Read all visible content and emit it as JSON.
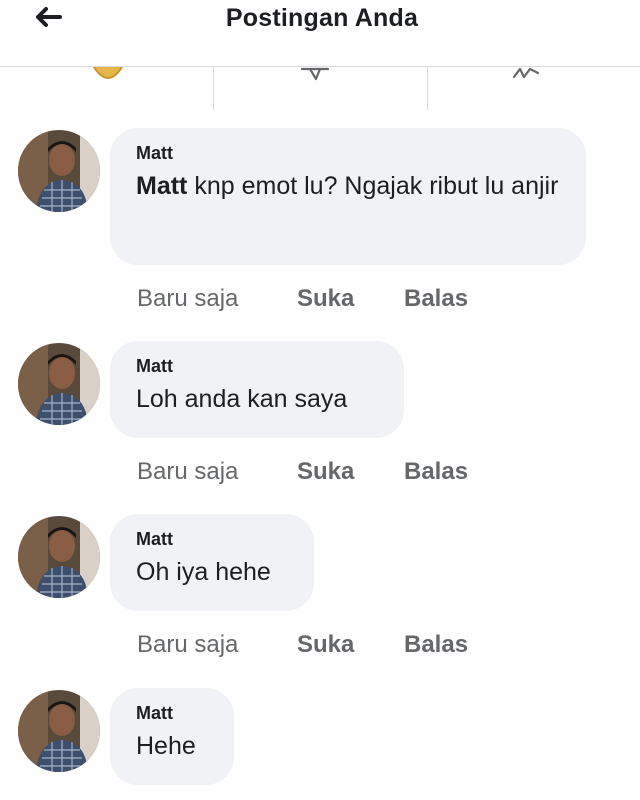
{
  "header": {
    "title": "Postingan Anda"
  },
  "comments": [
    {
      "author": "Matt",
      "mention": "Matt",
      "text": " knp emot lu? Ngajak ribut lu anjir",
      "time": "Baru saja",
      "like": "Suka",
      "reply": "Balas"
    },
    {
      "author": "Matt",
      "text": "Loh anda kan saya",
      "time": "Baru saja",
      "like": "Suka",
      "reply": "Balas"
    },
    {
      "author": "Matt",
      "text": "Oh iya hehe",
      "time": "Baru saja",
      "like": "Suka",
      "reply": "Balas"
    },
    {
      "author": "Matt",
      "text": "Hehe"
    }
  ],
  "colors": {
    "bubble": "#f0f2f5",
    "meta": "#65676b",
    "text": "#1c1e21"
  }
}
